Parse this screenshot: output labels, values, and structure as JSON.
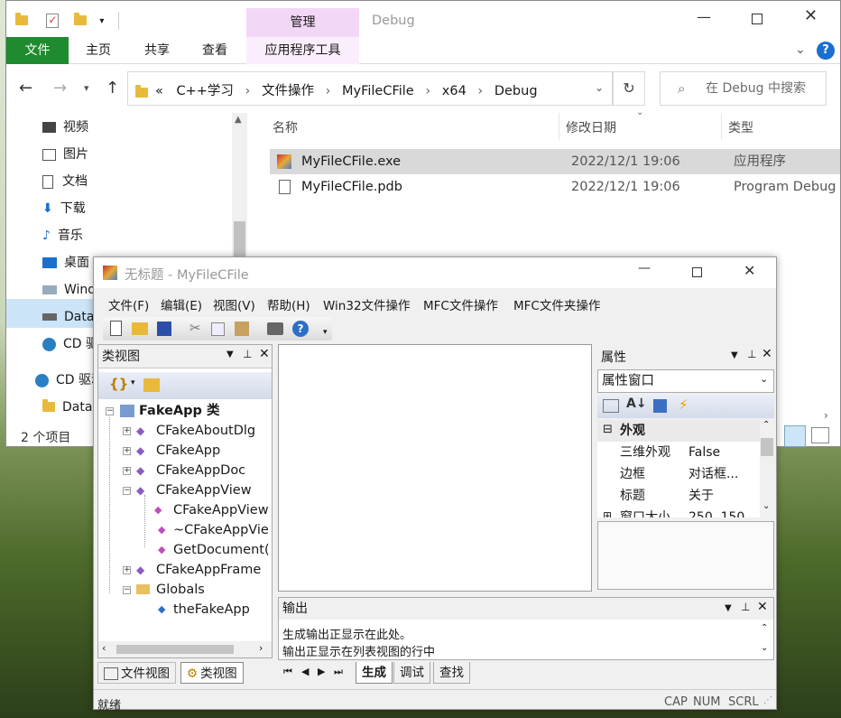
{
  "explorer": {
    "title": "Debug",
    "context_tab": "管理",
    "tabs": [
      "文件",
      "主页",
      "共享",
      "查看",
      "应用程序工具"
    ],
    "breadcrumb": [
      "«",
      "C++学习",
      "文件操作",
      "MyFileCFile",
      "x64",
      "Debug"
    ],
    "search_placeholder": "在 Debug 中搜索",
    "nav": [
      "视频",
      "图片",
      "文档",
      "下载",
      "音乐",
      "桌面",
      "Wind",
      "Data",
      "CD 驱",
      "CD 驱动",
      "Data"
    ],
    "columns": [
      "名称",
      "修改日期",
      "类型"
    ],
    "files": [
      {
        "name": "MyFileCFile.exe",
        "date": "2022/12/1 19:06",
        "type": "应用程序"
      },
      {
        "name": "MyFileCFile.pdb",
        "date": "2022/12/1 19:06",
        "type": "Program Debug ..."
      }
    ],
    "status": "2 个项目",
    "accent": "#1f8b2e"
  },
  "app": {
    "title": "无标题 - MyFileCFile",
    "menu": [
      "文件(F)",
      "编辑(E)",
      "视图(V)",
      "帮助(H)",
      "Win32文件操作",
      "MFC文件操作",
      "MFC文件夹操作"
    ],
    "classview": {
      "title": "类视图",
      "root": "FakeApp 类",
      "items": [
        "CFakeAboutDlg",
        "CFakeApp",
        "CFakeAppDoc",
        "CFakeAppView",
        "CFakeAppView",
        "~CFakeAppVie",
        "GetDocument(",
        "CFakeAppFrame",
        "Globals",
        "theFakeApp"
      ]
    },
    "left_tabs": [
      "文件视图",
      "类视图"
    ],
    "properties": {
      "title": "属性",
      "combo": "属性窗口",
      "category": "外观",
      "rows": [
        {
          "k": "三维外观",
          "v": "False"
        },
        {
          "k": "边框",
          "v": "对话框..."
        },
        {
          "k": "标题",
          "v": "关于"
        },
        {
          "k": "窗口大小",
          "v": "250, 150"
        }
      ]
    },
    "output": {
      "title": "输出",
      "lines": [
        "生成输出正显示在此处。",
        "输出正显示在列表视图的行中"
      ],
      "tabs": [
        "生成",
        "调试",
        "查找"
      ]
    },
    "status": {
      "text": "就绪",
      "ind": [
        "CAP",
        "NUM",
        "SCRL"
      ]
    }
  }
}
